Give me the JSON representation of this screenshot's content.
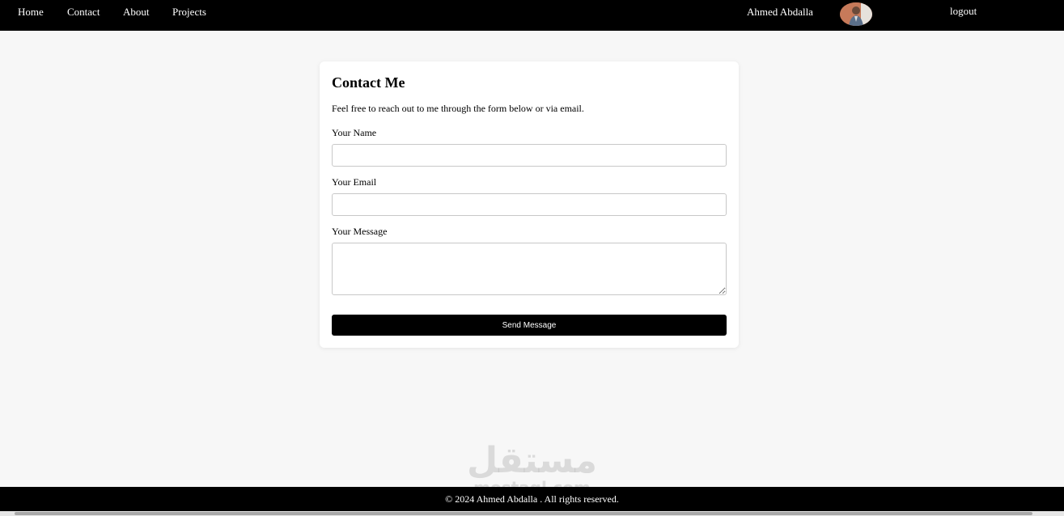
{
  "nav": {
    "links": [
      "Home",
      "Contact",
      "About",
      "Projects"
    ],
    "user_name": "Ahmed Abdalla",
    "avatar_icon": "user-avatar-photo",
    "logout_label": "logout"
  },
  "contact": {
    "title": "Contact Me",
    "description": "Feel free to reach out to me through the form below or via email.",
    "name_label": "Your Name",
    "name_value": "",
    "email_label": "Your Email",
    "email_value": "",
    "message_label": "Your Message",
    "message_value": "",
    "submit_label": "Send Message"
  },
  "watermark": {
    "arabic": "مستقل",
    "latin": "mostaql.com"
  },
  "footer": {
    "text": "© 2024 Ahmed Abdalla . All rights reserved."
  },
  "colors": {
    "navbar_bg": "#000000",
    "page_bg": "#f7f7f7",
    "button_bg": "#000000",
    "button_text": "#ffffff"
  }
}
